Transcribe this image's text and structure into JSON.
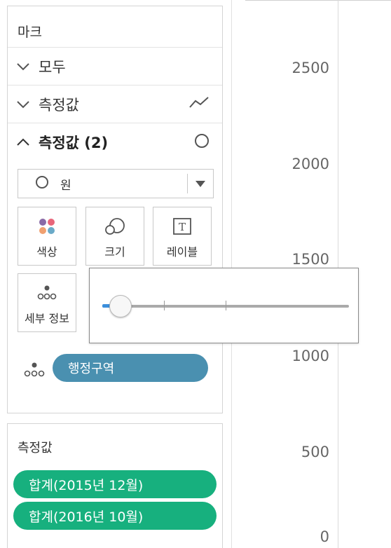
{
  "marks": {
    "title": "마크",
    "rows": [
      {
        "label": "모두",
        "expanded": false
      },
      {
        "label": "측정값",
        "expanded": false,
        "icon": "line-chart-icon"
      },
      {
        "label": "측정값 (2)",
        "expanded": true,
        "icon": "circle-icon"
      }
    ],
    "mark_type": {
      "label": "원",
      "icon": "circle-icon"
    },
    "cards": [
      {
        "label": "색상",
        "icon": "color-dots-icon"
      },
      {
        "label": "크기",
        "icon": "size-icon"
      },
      {
        "label": "레이블",
        "icon": "label-icon"
      },
      {
        "label": "세부 정보",
        "icon": "detail-icon"
      }
    ],
    "detail_pill": "행정구역"
  },
  "measures": {
    "title": "측정값",
    "pills": [
      "합계(2015년 12월)",
      "합계(2016년 10월)"
    ]
  },
  "axis": {
    "ticks": [
      "2500",
      "2000",
      "1500",
      "1000",
      "500",
      "0"
    ]
  },
  "size_slider": {
    "value_fraction": 0.04,
    "tick_fractions": [
      0.25,
      0.5
    ]
  },
  "colors": {
    "dimension_pill": "#4a90b0",
    "measure_pill": "#17b07e",
    "slider_fill": "#3b8fdc",
    "color_dots": [
      "#8a6aa6",
      "#e8667a",
      "#f0a070",
      "#6aaac8"
    ]
  }
}
